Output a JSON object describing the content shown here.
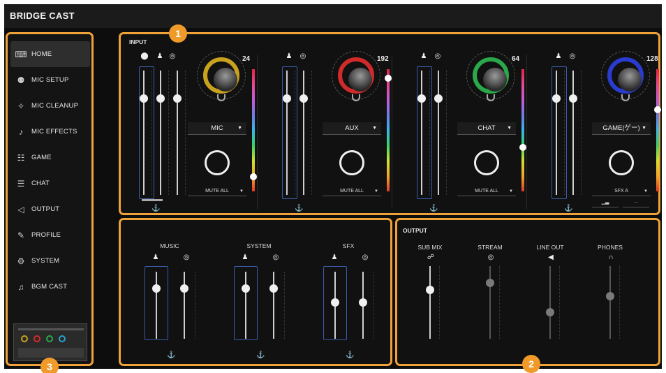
{
  "app": {
    "title": "BRIDGE CAST"
  },
  "sidebar": {
    "items": [
      {
        "label": "HOME",
        "icon": "⌨"
      },
      {
        "label": "MIC SETUP",
        "icon": "⚉"
      },
      {
        "label": "MIC CLEANUP",
        "icon": "✧"
      },
      {
        "label": "MIC EFFECTS",
        "icon": "♪"
      },
      {
        "label": "GAME",
        "icon": "☷"
      },
      {
        "label": "CHAT",
        "icon": "☰"
      },
      {
        "label": "OUTPUT",
        "icon": "◁"
      },
      {
        "label": "PROFILE",
        "icon": "✎"
      },
      {
        "label": "SYSTEM",
        "icon": "⚙"
      },
      {
        "label": "BGM CAST",
        "icon": "♫"
      }
    ],
    "active_index": 0
  },
  "badges": [
    "1",
    "2",
    "3"
  ],
  "input": {
    "label": "INPUT",
    "channels": [
      {
        "value": "24",
        "source": "MIC",
        "mute": "MUTE ALL",
        "ring_color": "#c8a21e",
        "meter_level": 0.1
      },
      {
        "value": "192",
        "source": "AUX",
        "mute": "MUTE ALL",
        "ring_color": "#d02a2a",
        "meter_level": 0.95
      },
      {
        "value": "64",
        "source": "CHAT",
        "mute": "MUTE ALL",
        "ring_color": "#2aa84a",
        "meter_level": 0.35
      },
      {
        "value": "128",
        "source": "GAME(ゲー)",
        "mute": "SFX A",
        "ring_color": "#2a3ccf",
        "meter_level": 0.68
      }
    ]
  },
  "bottom_mix": {
    "channels": [
      {
        "label": "MUSIC"
      },
      {
        "label": "SYSTEM"
      },
      {
        "label": "SFX"
      }
    ]
  },
  "output": {
    "label": "OUTPUT",
    "channels": [
      {
        "label": "SUB MIX",
        "icon": "☍",
        "level": 0.7
      },
      {
        "label": "STREAM",
        "icon": "◎",
        "level": 0.8
      },
      {
        "label": "LINE OUT",
        "icon": "◀",
        "level": 0.35
      },
      {
        "label": "PHONES",
        "icon": "∩",
        "level": 0.6
      }
    ]
  }
}
